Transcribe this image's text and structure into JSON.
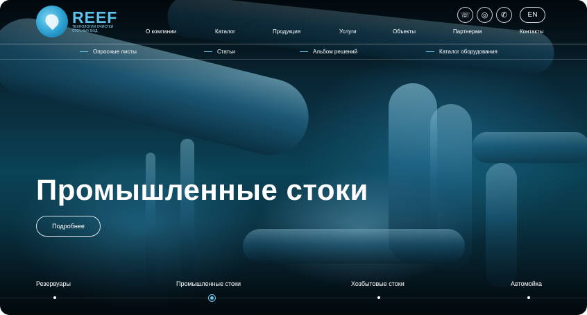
{
  "logo": {
    "title": "REEF",
    "subtitle": "ТЕХНОЛОГИИ ОЧИСТКИ СТОЧНЫХ ВОД"
  },
  "header_icons": [
    {
      "icon": "viber-icon",
      "glyph": "☏"
    },
    {
      "icon": "instagram-icon",
      "glyph": "◎"
    },
    {
      "icon": "whatsapp-icon",
      "glyph": "✆"
    }
  ],
  "lang": "EN",
  "nav": [
    "О компании",
    "Каталог",
    "Продукция",
    "Услуги",
    "Объекты",
    "Партнерам",
    "Контакты"
  ],
  "subnav": [
    "Опросные листы",
    "Статьи",
    "Альбом решений",
    "Каталог оборудования"
  ],
  "hero": {
    "title": "Промышленные стоки",
    "button": "Подробнее"
  },
  "slides": [
    "Резервуары",
    "Промышленные стоки",
    "Хозбытовые стоки",
    "Автомойка"
  ],
  "active_slide": 1,
  "colors": {
    "accent": "#6cc7ee",
    "logo": "#5cc2ec"
  }
}
